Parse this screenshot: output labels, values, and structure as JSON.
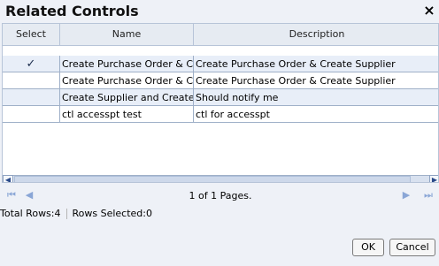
{
  "dialog": {
    "title": "Related Controls",
    "close": "×"
  },
  "grid": {
    "headers": {
      "select": "Select",
      "name": "Name",
      "description": "Description"
    },
    "rows": [
      {
        "select": "✓",
        "name": "Create Purchase Order & Crea",
        "description": "Create Purchase Order & Create Supplier"
      },
      {
        "select": "",
        "name": "Create Purchase Order & Crea",
        "description": "Create Purchase Order & Create Supplier"
      },
      {
        "select": "",
        "name": "Create Supplier and Create PO",
        "description": "Should notify me"
      },
      {
        "select": "",
        "name": "ctl accesspt test",
        "description": "ctl for accesspt"
      }
    ],
    "scroll": {
      "left": "◀",
      "right": "▶"
    }
  },
  "pager": {
    "first": "⏮",
    "prev": "◀",
    "next": "▶",
    "last": "⏭",
    "info": "1 of 1 Pages."
  },
  "status": {
    "total": "Total Rows:4",
    "selected": "Rows Selected:0"
  },
  "buttons": {
    "ok": "OK",
    "cancel": "Cancel"
  }
}
